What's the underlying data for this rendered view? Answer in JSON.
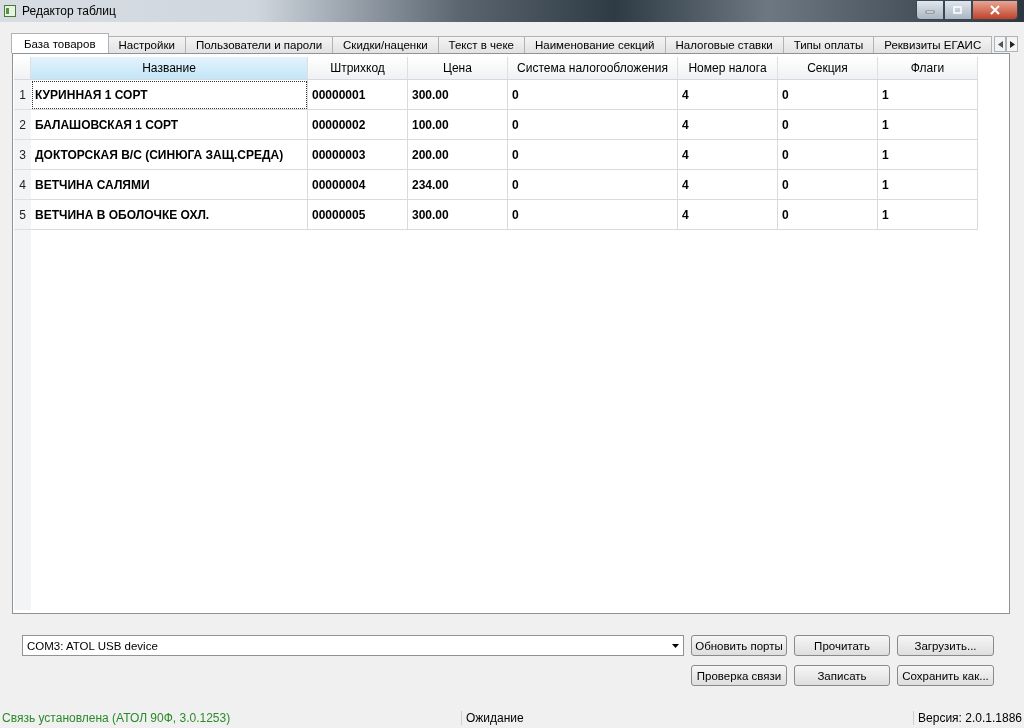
{
  "window": {
    "title": "Редактор таблиц"
  },
  "tabs": [
    {
      "label": "База товаров",
      "selected": true
    },
    {
      "label": "Настройки",
      "selected": false
    },
    {
      "label": "Пользователи и пароли",
      "selected": false
    },
    {
      "label": "Скидки/наценки",
      "selected": false
    },
    {
      "label": "Текст в чеке",
      "selected": false
    },
    {
      "label": "Наименование секций",
      "selected": false
    },
    {
      "label": "Налоговые ставки",
      "selected": false
    },
    {
      "label": "Типы оплаты",
      "selected": false
    },
    {
      "label": "Реквизиты ЕГАИС",
      "selected": false
    }
  ],
  "table": {
    "columns": [
      {
        "label": "Название",
        "selected": true
      },
      {
        "label": "Штрихкод",
        "selected": false
      },
      {
        "label": "Цена",
        "selected": false
      },
      {
        "label": "Система налогообложения",
        "selected": false
      },
      {
        "label": "Номер налога",
        "selected": false
      },
      {
        "label": "Секция",
        "selected": false
      },
      {
        "label": "Флаги",
        "selected": false
      }
    ],
    "rows": [
      {
        "number": "1",
        "focused": true,
        "cells": [
          "КУРИННАЯ 1 СОРТ",
          "00000001",
          "300.00",
          "0",
          "4",
          "0",
          "1"
        ]
      },
      {
        "number": "2",
        "focused": false,
        "cells": [
          "БАЛАШОВСКАЯ 1 СОРТ",
          "00000002",
          "100.00",
          "0",
          "4",
          "0",
          "1"
        ]
      },
      {
        "number": "3",
        "focused": false,
        "cells": [
          "ДОКТОРСКАЯ В/С (СИНЮГА ЗАЩ.СРЕДА)",
          "00000003",
          "200.00",
          "0",
          "4",
          "0",
          "1"
        ]
      },
      {
        "number": "4",
        "focused": false,
        "cells": [
          "ВЕТЧИНА САЛЯМИ",
          "00000004",
          "234.00",
          "0",
          "4",
          "0",
          "1"
        ]
      },
      {
        "number": "5",
        "focused": false,
        "cells": [
          "ВЕТЧИНА В ОБОЛОЧКЕ ОХЛ.",
          "00000005",
          "300.00",
          "0",
          "4",
          "0",
          "1"
        ]
      }
    ]
  },
  "port": {
    "value": "COM3: ATOL USB device"
  },
  "buttons": [
    "Обновить порты",
    "Прочитать",
    "Загрузить...",
    "Проверка связи",
    "Записать",
    "Сохранить как..."
  ],
  "status_bar": {
    "connection": "Связь установлена (АТОЛ 90Ф, 3.0.1253)",
    "state": "Ожидание",
    "version": "Версия: 2.0.1.1886"
  }
}
